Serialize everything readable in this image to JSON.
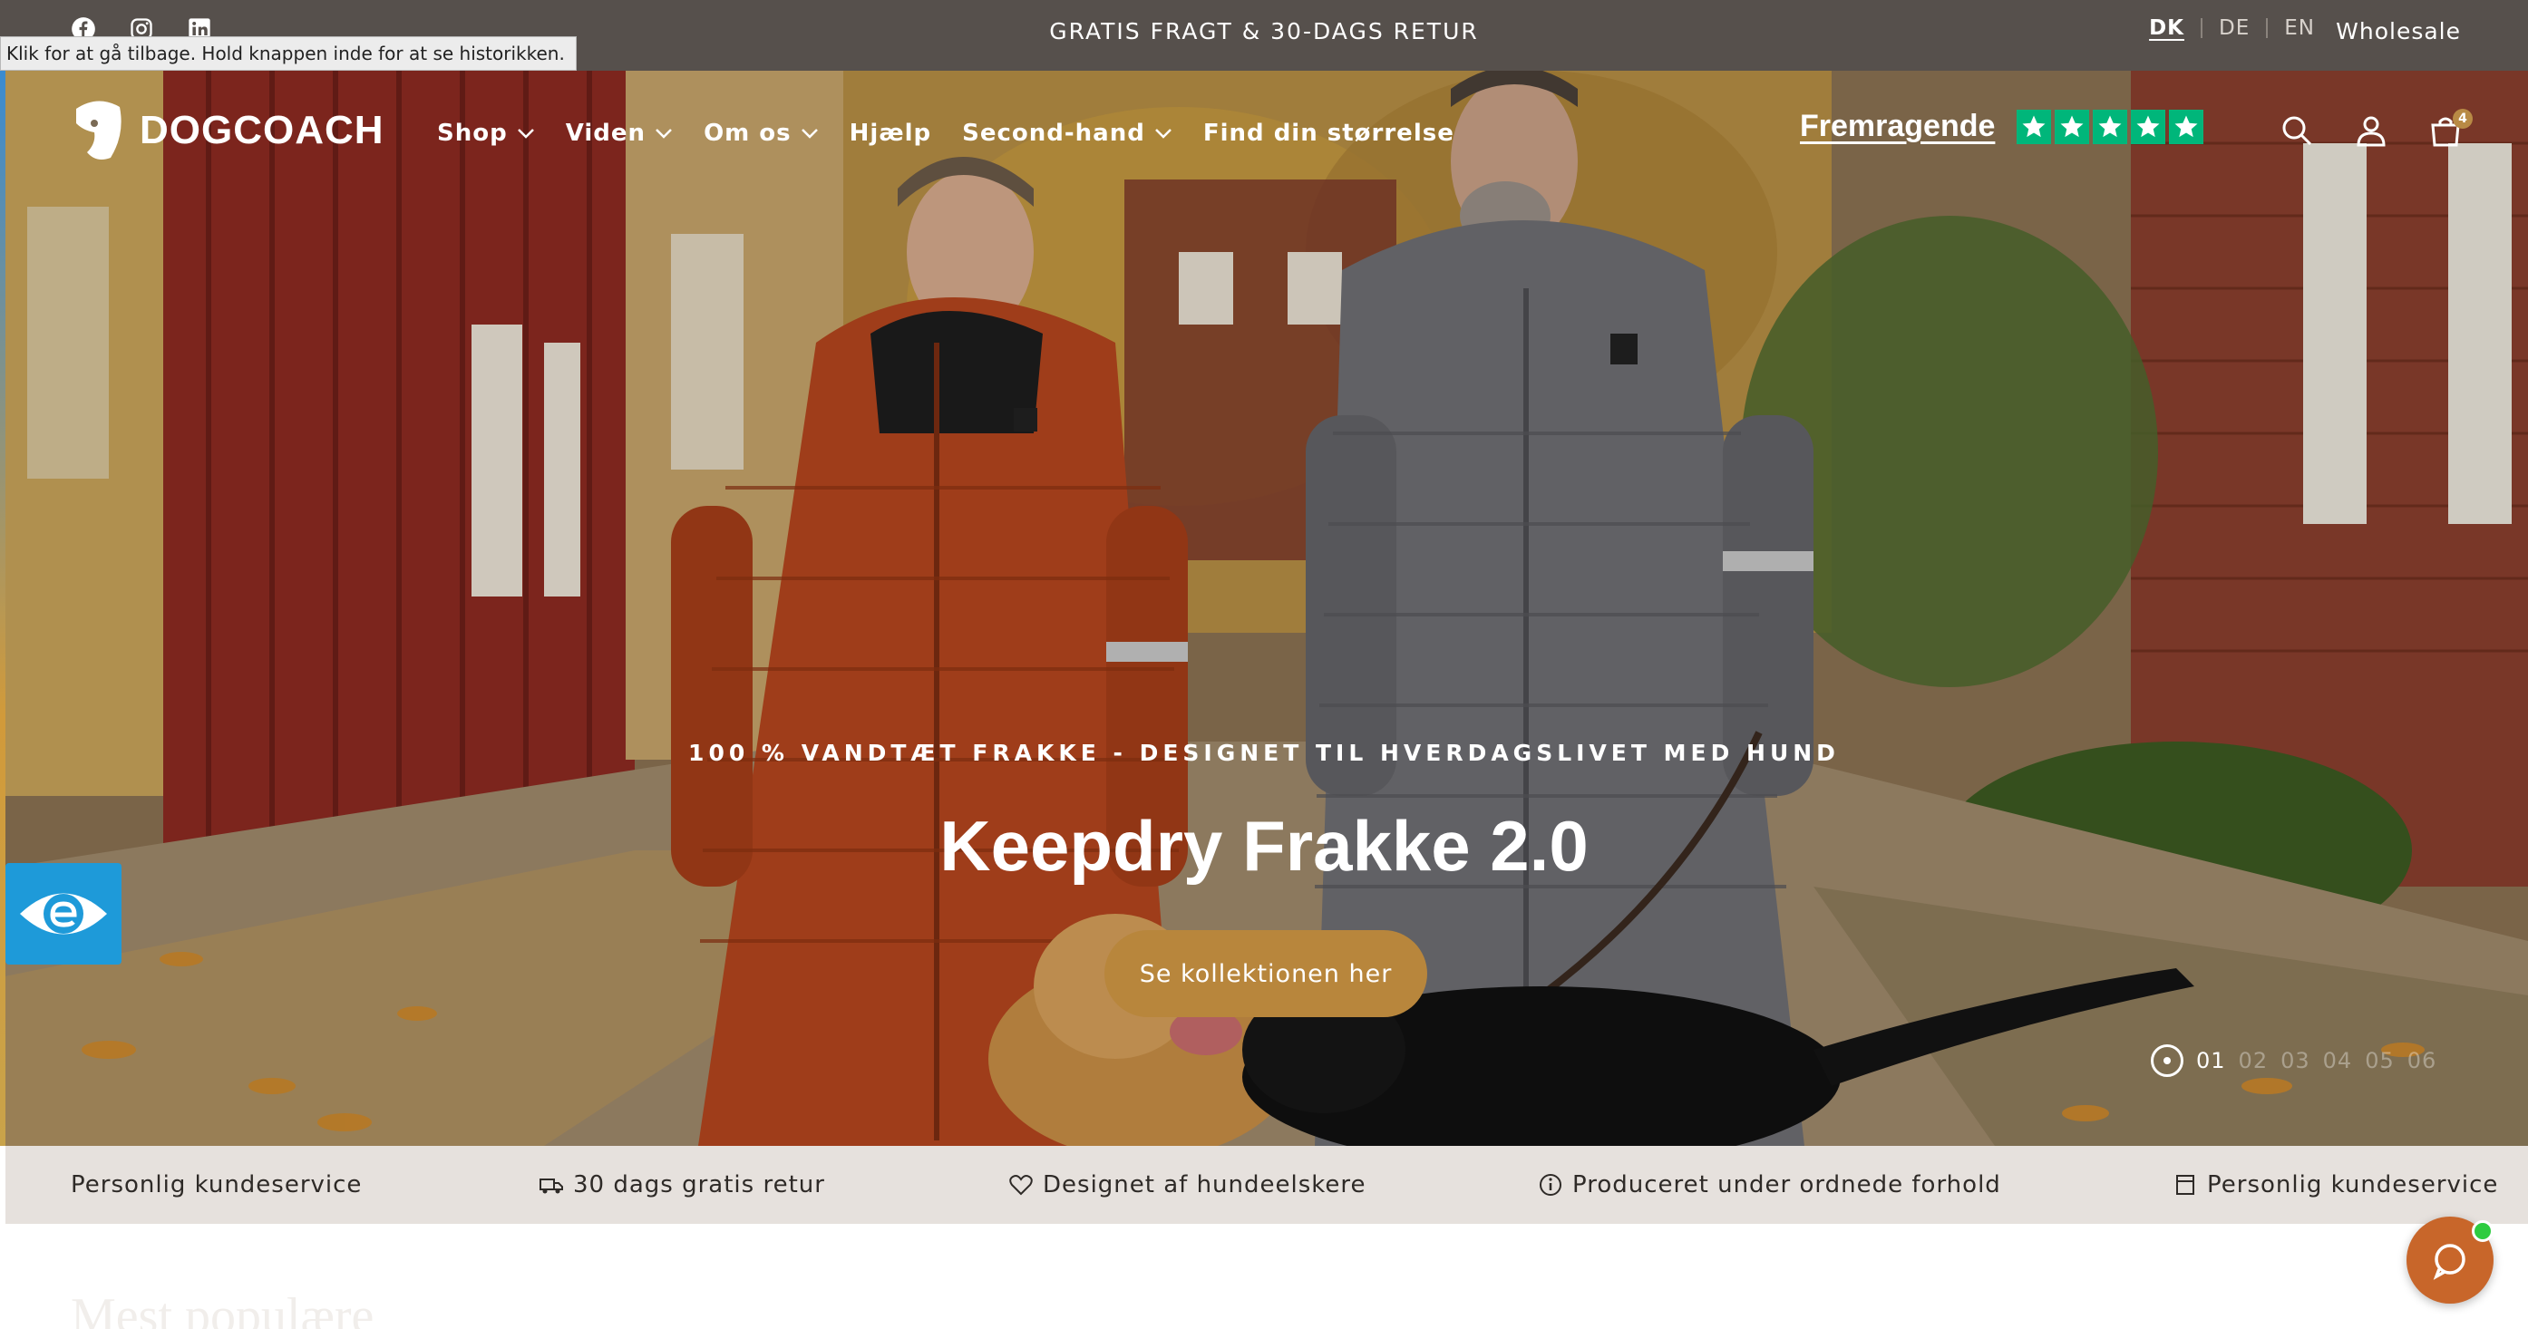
{
  "announcement": {
    "text": "GRATIS FRAGT & 30-DAGS RETUR",
    "social": [
      "facebook-icon",
      "instagram-icon",
      "linkedin-icon"
    ]
  },
  "languages": {
    "options": [
      "DK",
      "DE",
      "EN"
    ],
    "active": "DK"
  },
  "wholesale_label": "Wholesale",
  "tooltip": "Klik for at gå tilbage. Hold knappen inde for at se historikken.",
  "brand": {
    "name": "DOGCOACH"
  },
  "nav": [
    {
      "label": "Shop",
      "dropdown": true
    },
    {
      "label": "Viden",
      "dropdown": true
    },
    {
      "label": "Om os",
      "dropdown": true
    },
    {
      "label": "Hjælp",
      "dropdown": false
    },
    {
      "label": "Second-hand",
      "dropdown": true
    },
    {
      "label": "Find din størrelse",
      "dropdown": false
    }
  ],
  "trustpilot": {
    "label": "Fremragende",
    "stars": 5,
    "color": "#00b67a"
  },
  "header_icons": [
    "search-icon",
    "account-icon",
    "cart-icon"
  ],
  "cart_count": "4",
  "hero": {
    "eyebrow": "100 % VANDTÆT FRAKKE - DESIGNET TIL HVERDAGSLIVET MED HUND",
    "title": "Keepdry Frakke 2.0",
    "cta": "Se kollektionen her",
    "cta_color": "#b8863c",
    "slides": [
      "01",
      "02",
      "03",
      "04",
      "05",
      "06"
    ],
    "active_slide": "01"
  },
  "usp": [
    {
      "icon": "phone-icon",
      "label": "Personlig kundeservice"
    },
    {
      "icon": "truck-icon",
      "label": "30 dags gratis retur"
    },
    {
      "icon": "heart-icon",
      "label": "Designet af hundeelskere"
    },
    {
      "icon": "info-icon",
      "label": "Produceret under ordnede forhold"
    },
    {
      "icon": "phone-icon",
      "label": "Personlig kundeservice"
    }
  ],
  "below_fold_title": "Mest populære",
  "colors": {
    "announcement_bg": "#56504c",
    "usp_bg": "#e6e1dd",
    "chat_bg": "#c8662a",
    "a11y_bg": "#1e9ad9"
  }
}
